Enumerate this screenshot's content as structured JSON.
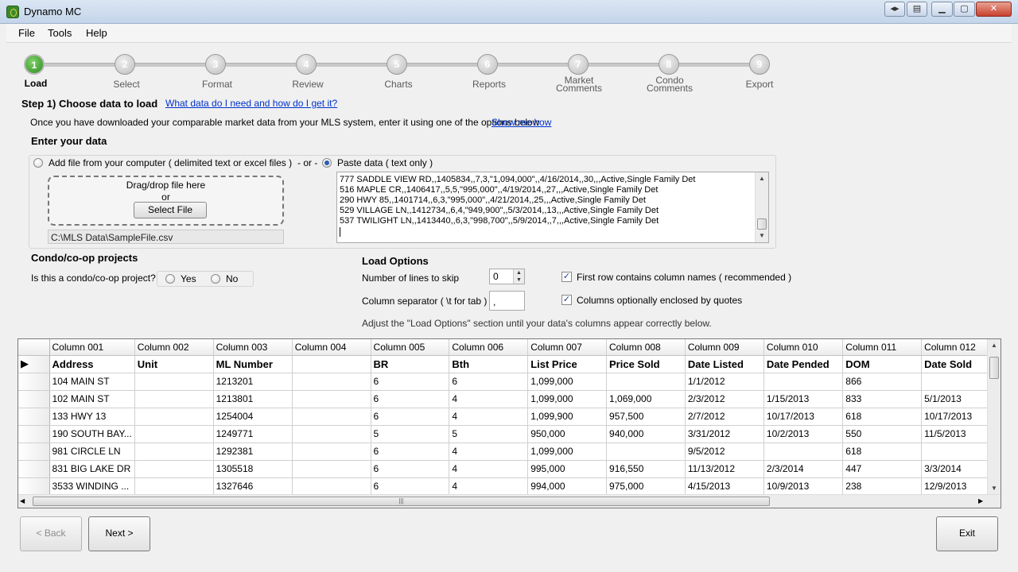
{
  "window": {
    "title": "Dynamo MC"
  },
  "menu": [
    "File",
    "Tools",
    "Help"
  ],
  "steps": [
    {
      "num": "1",
      "label": "Load"
    },
    {
      "num": "2",
      "label": "Select"
    },
    {
      "num": "3",
      "label": "Format"
    },
    {
      "num": "4",
      "label": "Review"
    },
    {
      "num": "5",
      "label": "Charts"
    },
    {
      "num": "6",
      "label": "Reports"
    },
    {
      "num": "7",
      "label": "Market",
      "label2": "Comments"
    },
    {
      "num": "8",
      "label": "Condo",
      "label2": "Comments"
    },
    {
      "num": "9",
      "label": "Export"
    }
  ],
  "header": {
    "step_title": "Step  1) Choose data to load",
    "help_link": "What data do I need and how do I get it?",
    "intro": "Once you have downloaded your comparable market data from your MLS system, enter it using one of the options below",
    "show_me_link": "Show me how",
    "enter_data": "Enter your data"
  },
  "input": {
    "add_file_label": "Add file from your computer ( delimited text or excel files )",
    "or_label": "- or -",
    "paste_label": "Paste data ( text only )",
    "drop_line1": "Drag/drop file here",
    "drop_line2": "or",
    "select_file": "Select File",
    "file_path": "C:\\MLS Data\\SampleFile.csv",
    "paste_lines": [
      "777 SADDLE VIEW RD,,1405834,,7,3,\"1,094,000\",,4/16/2014,,30,,,Active,Single Family Det",
      "516 MAPLE CR,,1406417,,5,5,\"995,000\",,4/19/2014,,27,,,Active,Single Family Det",
      "290 HWY 85,,1401714,,6,3,\"995,000\",,4/21/2014,,25,,,Active,Single Family Det",
      "529 VILLAGE LN,,1412734,,6,4,\"949,900\",,5/3/2014,,13,,,Active,Single Family Det",
      "537 TWILIGHT LN,,1413440,,6,3,\"998,700\",,5/9/2014,,7,,,Active,Single Family Det"
    ]
  },
  "condo": {
    "heading": "Condo/co-op projects",
    "question": "Is this a condo/co-op project?",
    "yes": "Yes",
    "no": "No"
  },
  "load_options": {
    "heading": "Load Options",
    "skip_label": "Number of lines to skip",
    "skip_value": "0",
    "separator_label": "Column separator  ( \\t for tab )",
    "separator_value": ",",
    "first_row_label": "First row contains column names ( recommended )",
    "quotes_label": "Columns optionally enclosed by quotes",
    "adjust_hint": "Adjust the \"Load Options\" section until your data's columns appear correctly below."
  },
  "grid": {
    "columns": [
      "Column 001",
      "Column 002",
      "Column 003",
      "Column 004",
      "Column 005",
      "Column 006",
      "Column 007",
      "Column 008",
      "Column 009",
      "Column 010",
      "Column 011",
      "Column 012"
    ],
    "names": [
      "Address",
      "Unit",
      "ML Number",
      "",
      "BR",
      "Bth",
      "List Price",
      "Price Sold",
      "Date Listed",
      "Date Pended",
      "DOM",
      "Date Sold"
    ],
    "rows": [
      [
        "104 MAIN ST",
        "",
        "1213201",
        "",
        "6",
        "6",
        "1,099,000",
        "",
        "1/1/2012",
        "",
        "866",
        ""
      ],
      [
        "102 MAIN ST",
        "",
        "1213801",
        "",
        "6",
        "4",
        "1,099,000",
        "1,069,000",
        "2/3/2012",
        "1/15/2013",
        "833",
        "5/1/2013"
      ],
      [
        "133 HWY 13",
        "",
        "1254004",
        "",
        "6",
        "4",
        "1,099,900",
        "957,500",
        "2/7/2012",
        "10/17/2013",
        "618",
        "10/17/2013"
      ],
      [
        "190 SOUTH BAY...",
        "",
        "1249771",
        "",
        "5",
        "5",
        "950,000",
        "940,000",
        "3/31/2012",
        "10/2/2013",
        "550",
        "11/5/2013"
      ],
      [
        "981 CIRCLE LN",
        "",
        "1292381",
        "",
        "6",
        "4",
        "1,099,000",
        "",
        "9/5/2012",
        "",
        "618",
        ""
      ],
      [
        "831 BIG LAKE DR",
        "",
        "1305518",
        "",
        "6",
        "4",
        "995,000",
        "916,550",
        "11/13/2012",
        "2/3/2014",
        "447",
        "3/3/2014"
      ],
      [
        "3533 WINDING ...",
        "",
        "1327646",
        "",
        "6",
        "4",
        "994,000",
        "975,000",
        "4/15/2013",
        "10/9/2013",
        "238",
        "12/9/2013"
      ]
    ]
  },
  "nav": {
    "back": "< Back",
    "next": "Next >",
    "exit": "Exit"
  }
}
